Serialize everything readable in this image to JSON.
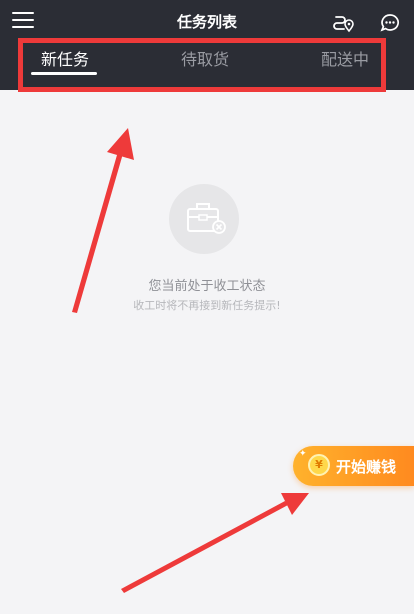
{
  "header": {
    "title": "任务列表",
    "menu_icon": "menu-icon",
    "route_icon": "route-location-icon",
    "chat_icon": "chat-icon"
  },
  "tabs": [
    {
      "label": "新任务",
      "active": true
    },
    {
      "label": "待取货",
      "active": false
    },
    {
      "label": "配送中",
      "active": false
    }
  ],
  "empty_state": {
    "icon": "toolbox-closed-icon",
    "title": "您当前处于收工状态",
    "subtitle": "收工时将不再接到新任务提示!"
  },
  "earn_button": {
    "label": "开始赚钱",
    "coin_symbol": "¥",
    "icon": "coin-icon"
  },
  "colors": {
    "header_bg": "#2b2d35",
    "page_bg": "#f4f4f6",
    "annotation_red": "#ee3a3a",
    "earn_orange": "#ff9a24"
  }
}
